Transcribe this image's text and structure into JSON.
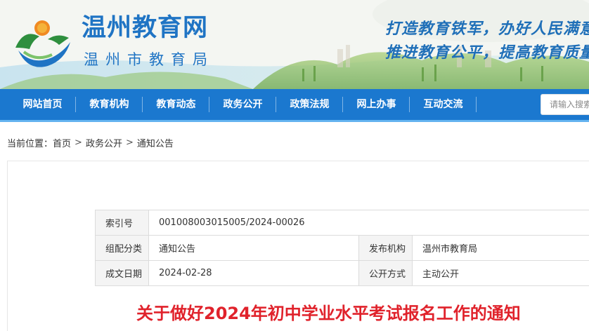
{
  "header": {
    "site_title": "温州教育网",
    "site_subtitle": "温州市教育局",
    "slogan_line1": "打造教育铁军，办好人民满意教育",
    "slogan_line2": "推进教育公平，提高教育质量",
    "logo_icon": "wenzhou-education-logo"
  },
  "nav": {
    "items": [
      {
        "label": "网站首页"
      },
      {
        "label": "教育机构"
      },
      {
        "label": "教育动态"
      },
      {
        "label": "政务公开"
      },
      {
        "label": "政策法规"
      },
      {
        "label": "网上办事"
      },
      {
        "label": "互动交流"
      }
    ],
    "search_placeholder": "请输入搜索"
  },
  "breadcrumb": {
    "prefix": "当前位置：",
    "items": [
      "首页",
      "政务公开",
      "通知公告"
    ],
    "separator": ">"
  },
  "meta": {
    "index_label": "索引号",
    "index_value": "001008003015005/2024-00026",
    "category_label": "组配分类",
    "category_value": "通知公告",
    "publisher_label": "发布机构",
    "publisher_value": "温州市教育局",
    "date_label": "成文日期",
    "date_value": "2024-02-28",
    "disclosure_label": "公开方式",
    "disclosure_value": "主动公开"
  },
  "article": {
    "title": "关于做好2024年初中学业水平考试报名工作的通知"
  },
  "colors": {
    "brand_blue": "#1b78cf",
    "title_red": "#e0222b",
    "nav_underline": "#64b3f0"
  }
}
